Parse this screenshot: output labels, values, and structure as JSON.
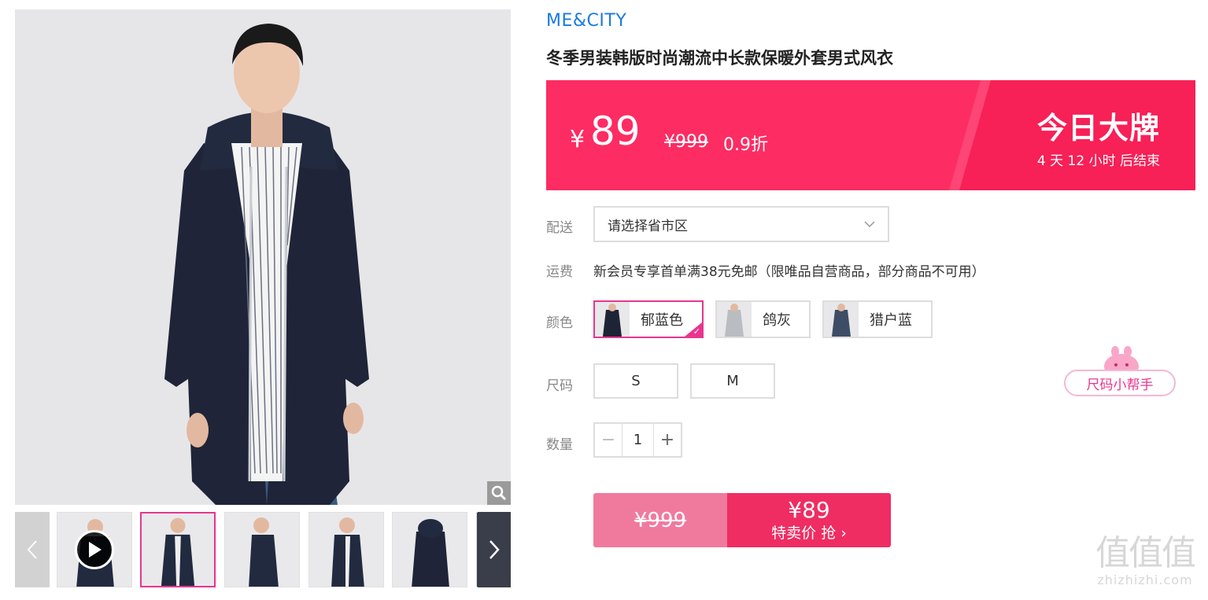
{
  "brand": "ME&CITY",
  "product_title": "冬季男装韩版时尚潮流中长款保暖外套男式风衣",
  "price_banner": {
    "currency": "¥",
    "price": "89",
    "original_price": "¥999",
    "discount": "0.9折",
    "tag": "今日大牌",
    "countdown": "4 天 12 小时 后结束"
  },
  "delivery": {
    "label": "配送",
    "placeholder": "请选择省市区"
  },
  "shipping": {
    "label": "运费",
    "text": "新会员专享首单满38元免邮（限唯品自营商品，部分商品不可用）"
  },
  "colors": {
    "label": "颜色",
    "options": [
      {
        "name": "郁蓝色",
        "selected": true,
        "coat_color": "#1e2436"
      },
      {
        "name": "鸽灰",
        "selected": false,
        "coat_color": "#b9bcc1"
      },
      {
        "name": "猎户蓝",
        "selected": false,
        "coat_color": "#3e4d66"
      }
    ]
  },
  "sizes": {
    "label": "尺码",
    "options": [
      "S",
      "M"
    ]
  },
  "quantity": {
    "label": "数量",
    "value": "1",
    "minus": "−",
    "plus": "+"
  },
  "size_helper": "尺码小帮手",
  "buy_button": {
    "original": "¥999",
    "price": "¥89",
    "label": "特卖价 抢 ›"
  },
  "watermark": {
    "logo": "值值值",
    "url": "zhizhizhi.com"
  },
  "colors_theme": {
    "accent": "#fd2c63",
    "brand_blue": "#1a7be0",
    "select_pink": "#e8358f"
  }
}
